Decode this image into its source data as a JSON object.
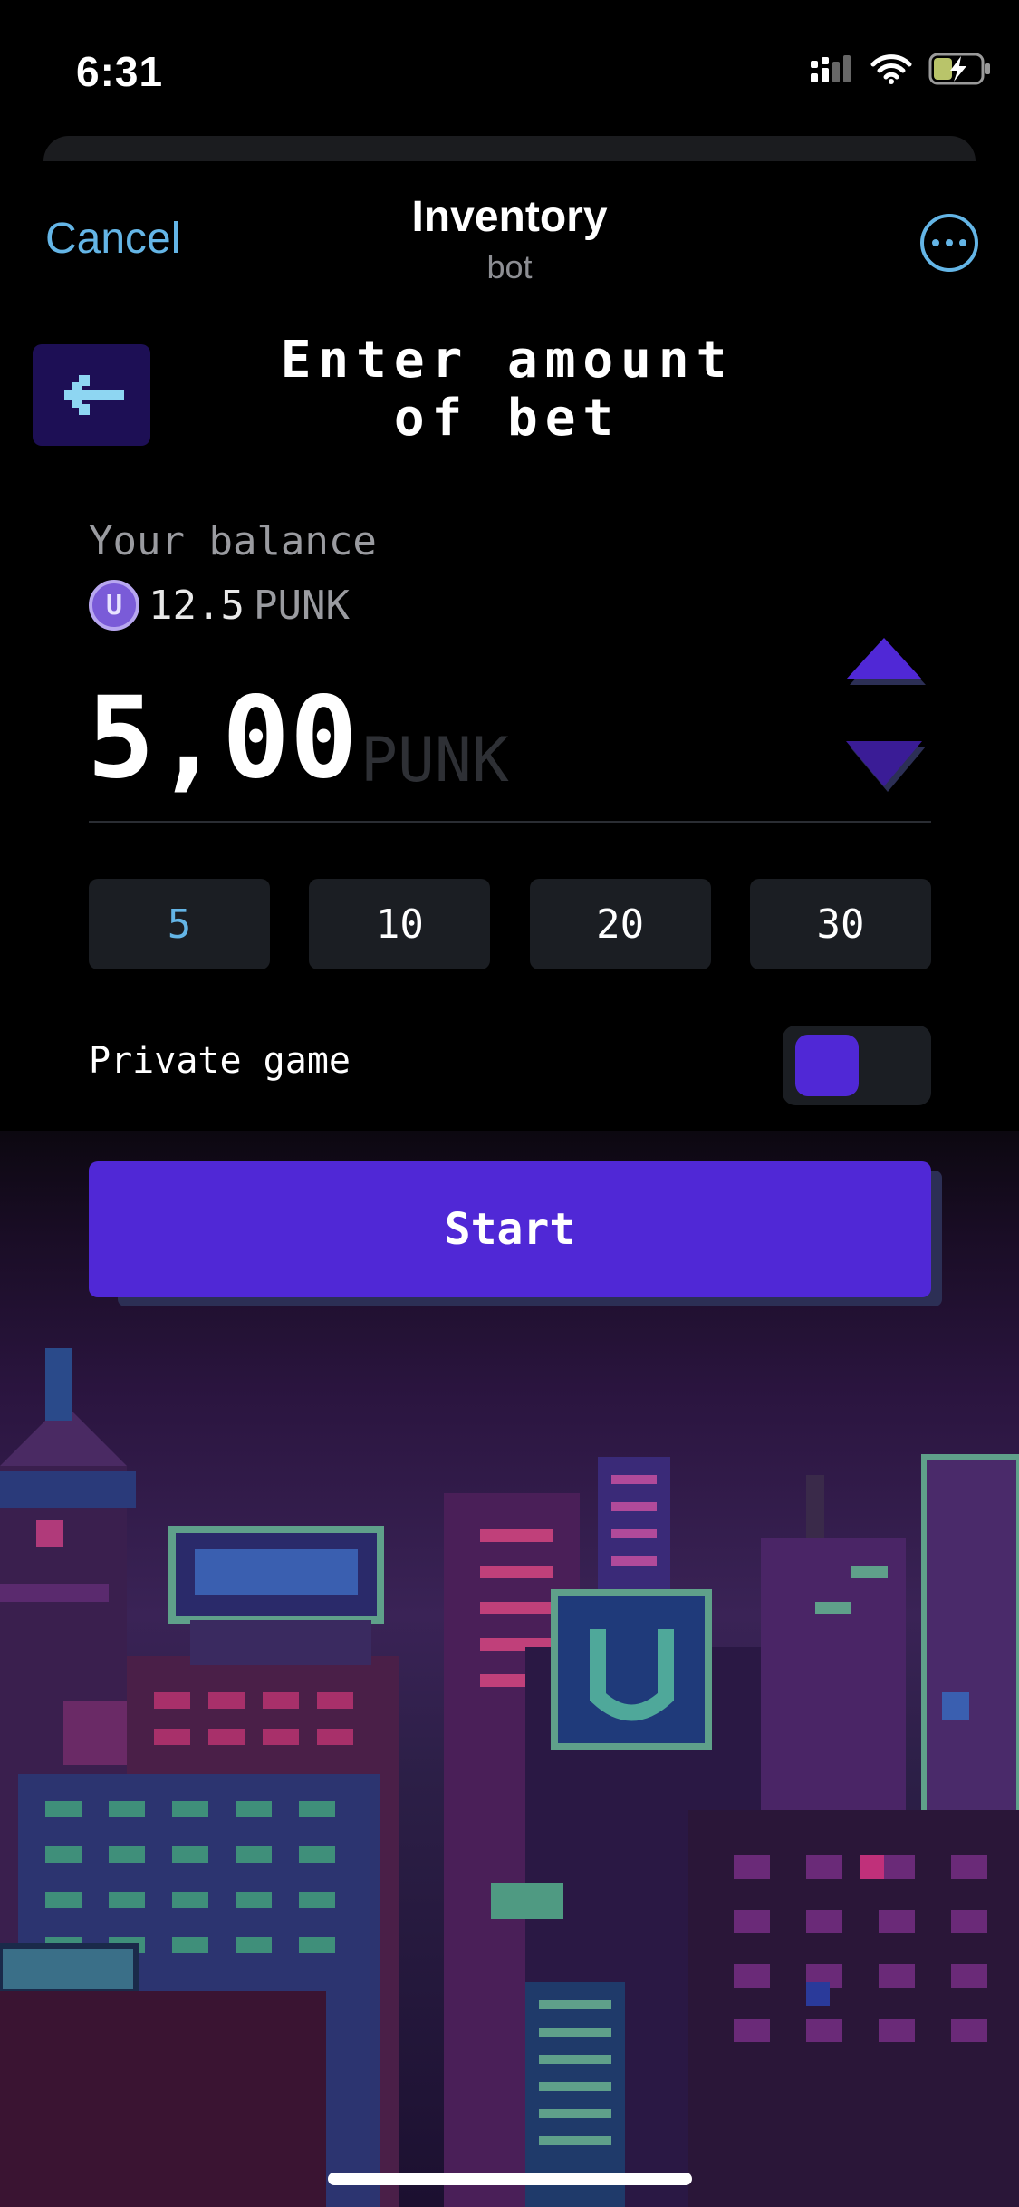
{
  "status_bar": {
    "time": "6:31"
  },
  "nav": {
    "cancel_label": "Cancel",
    "title": "Inventory",
    "subtitle": "bot"
  },
  "heading": {
    "line1": "Enter amount",
    "line2": "of bet"
  },
  "balance": {
    "label": "Your balance",
    "value": "12.5",
    "unit": "PUNK",
    "coin_glyph": "U"
  },
  "bet": {
    "amount": "5,00",
    "unit": "PUNK"
  },
  "presets": [
    "5",
    "10",
    "20",
    "30"
  ],
  "private_game": {
    "label": "Private game",
    "enabled": false
  },
  "start_label": "Start",
  "colors": {
    "accent": "#5028d6",
    "link": "#64b5e6",
    "background": "#000000"
  },
  "icons": [
    "signal-icon",
    "wifi-icon",
    "battery-charging-icon",
    "more-icon",
    "arrow-left-icon",
    "arrow-up-icon",
    "arrow-down-icon",
    "punk-coin-icon"
  ]
}
